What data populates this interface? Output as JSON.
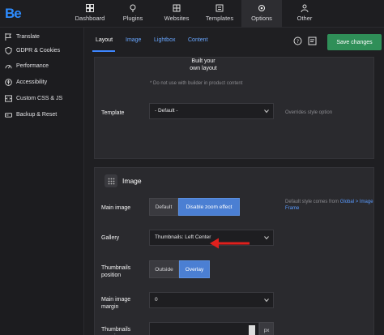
{
  "brand": {
    "logo": "Be"
  },
  "top_nav": [
    {
      "label": "Dashboard",
      "icon": "dashboard-icon"
    },
    {
      "label": "Plugins",
      "icon": "plugin-icon"
    },
    {
      "label": "Websites",
      "icon": "globe-icon"
    },
    {
      "label": "Templates",
      "icon": "template-icon"
    },
    {
      "label": "Options",
      "icon": "gear-icon",
      "active": true
    },
    {
      "label": "Other",
      "icon": "other-icon"
    }
  ],
  "sidebar": [
    {
      "label": "Translate",
      "icon": "flag-icon"
    },
    {
      "label": "GDPR & Cookies",
      "icon": "shield-icon"
    },
    {
      "label": "Performance",
      "icon": "gauge-icon"
    },
    {
      "label": "Accessibility",
      "icon": "accessibility-icon"
    },
    {
      "label": "Custom CSS & JS",
      "icon": "code-icon"
    },
    {
      "label": "Backup & Reset",
      "icon": "backup-icon"
    }
  ],
  "tabs": [
    "Layout",
    "Image",
    "Lightbox",
    "Content"
  ],
  "actions": {
    "save_label": "Save changes"
  },
  "panel_layout": {
    "built_label_line1": "Built your",
    "built_label_line2": "own layout",
    "builder_note": "* Do not use with builder in product content",
    "template_label": "Template",
    "template_value": "- Default -",
    "template_help": "Overrides style option"
  },
  "panel_image": {
    "title": "Image",
    "main_image_label": "Main image",
    "main_image_options": [
      "Default",
      "Disable zoom effect"
    ],
    "main_image_selected": "Disable zoom effect",
    "main_image_help_prefix": "Default style comes from",
    "main_image_help_link": "Global > Image Frame",
    "gallery_label": "Gallery",
    "gallery_value": "Thumbnails: Left Center",
    "thumb_pos_label_line1": "Thumbnails",
    "thumb_pos_label_line2": "position",
    "thumb_pos_options": [
      "Outside",
      "Overlay"
    ],
    "thumb_pos_selected": "Overlay",
    "main_margin_label_line1": "Main image",
    "main_margin_label_line2": "margin",
    "main_margin_value": "0",
    "thumb_margin_label_line1": "Thumbnails",
    "thumb_margin_label_line2": "margin",
    "thumb_margin_value": "",
    "thumb_margin_unit": "px"
  },
  "colors": {
    "accent": "#4b7fd3",
    "save": "#2f8f58",
    "arrow": "#e0201d"
  }
}
